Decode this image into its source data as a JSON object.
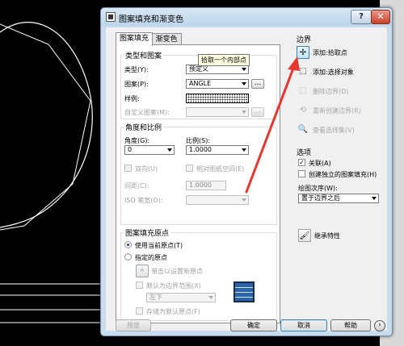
{
  "dialog": {
    "title": "图案填充和渐变色",
    "help_label": "?",
    "close_label": "✕"
  },
  "tabs": [
    {
      "label": "图案填充"
    },
    {
      "label": "渐变色"
    }
  ],
  "type_pattern": {
    "section_title": "类型和图案",
    "type_label": "类型(Y):",
    "type_value": "预定义",
    "pattern_label": "图案(P):",
    "pattern_value": "ANGLE",
    "pattern_button": "...",
    "swatch_label": "样例:",
    "custom_label": "自定义图案(M):",
    "custom_button": "..."
  },
  "angle_scale": {
    "section_title": "角度和比例",
    "angle_label": "角度(G):",
    "angle_value": "0",
    "scale_label": "比例(S):",
    "scale_value": "1.0000",
    "double_label": "双向(U)",
    "relative_label": "相对图纸空间(E)",
    "spacing_label": "间距(C):",
    "spacing_value": "1.0000",
    "iso_label": "ISO 笔宽(O):"
  },
  "origin": {
    "section_title": "图案填充原点",
    "use_current_label": "使用当前原点(T)",
    "specified_label": "指定的原点",
    "click_label": "单击以设置新原点",
    "default_extent_label": "默认为边界范围(X)",
    "position_value": "左下",
    "store_label": "存储为默认原点(F)"
  },
  "boundaries": {
    "section_title": "边界",
    "add_pick_label": "添加:拾取点",
    "add_select_label": "添加:选择对象",
    "remove_label": "删除边界(D)",
    "recreate_label": "重新创建边界(R)",
    "view_label": "查看选择集(V)",
    "tooltip": "拾取一个内部点"
  },
  "options": {
    "section_title": "选项",
    "associative_label": "关联(A)",
    "associative_checked": true,
    "separate_label": "创建独立的图案填充(H)",
    "draw_order_label": "绘图次序(W):",
    "draw_order_value": "置于边界之后"
  },
  "inherit_label": "继承特性",
  "footer": {
    "preview_label": "预览",
    "ok_label": "确定",
    "cancel_label": "取消",
    "help_label": "帮助",
    "more_label": "›"
  },
  "colors": {
    "annotation_arrow": "#e8352e",
    "titlebar": "#bcd4ea",
    "drawing_background": "#000000"
  }
}
